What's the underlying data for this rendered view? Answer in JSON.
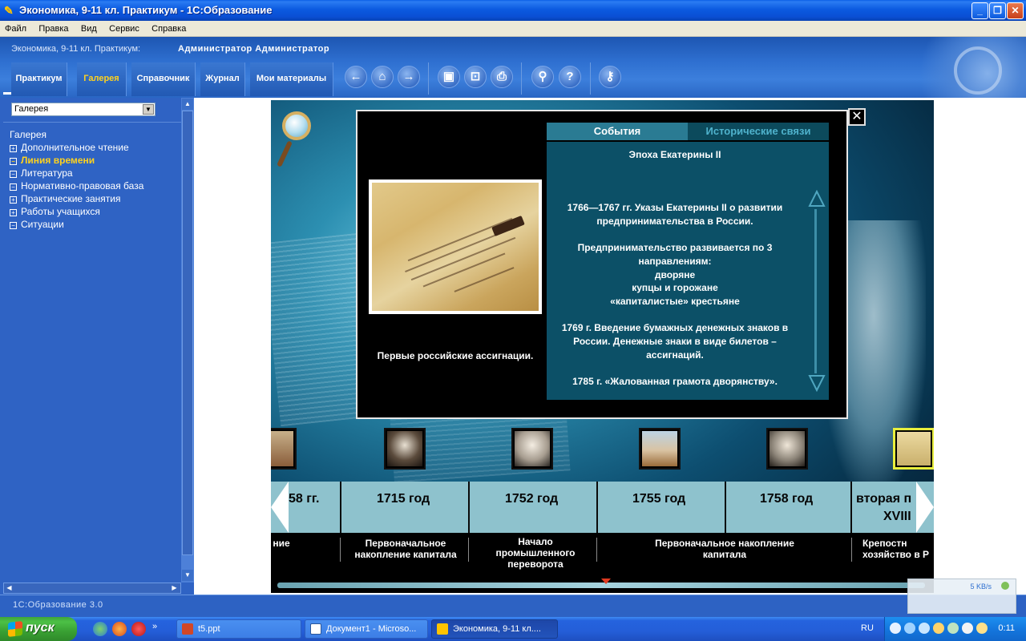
{
  "window": {
    "title": "Экономика, 9-11 кл. Практикум - 1С:Образование",
    "controls": [
      "minimize",
      "maximize",
      "close"
    ]
  },
  "menubar": [
    "Файл",
    "Правка",
    "Вид",
    "Сервис",
    "Справка"
  ],
  "app_header": {
    "course": "Экономика, 9-11 кл. Практикум:",
    "user": "Администратор Администратор",
    "nav_tabs": [
      {
        "label": "Практикум",
        "active": false
      },
      {
        "label": "Галерея",
        "active": true
      },
      {
        "label": "Справочник",
        "active": false
      },
      {
        "label": "Журнал",
        "active": false
      },
      {
        "label": "Мои материалы",
        "active": false
      }
    ],
    "toolbar_icons": [
      "arrow-left-icon",
      "home-icon",
      "arrow-right-icon",
      "fullscreen-icon",
      "presentation-icon",
      "print-icon",
      "search-icon",
      "help-icon",
      "key-icon"
    ]
  },
  "sidebar": {
    "select_value": "Галерея",
    "tree": [
      {
        "label": "Галерея",
        "box": ""
      },
      {
        "label": "Дополнительное чтение",
        "box": "+"
      },
      {
        "label": "Линия времени",
        "box": "−",
        "active": true
      },
      {
        "label": "Литература",
        "box": "−"
      },
      {
        "label": "Нормативно-правовая база",
        "box": "−"
      },
      {
        "label": "Практические занятия",
        "box": "+"
      },
      {
        "label": "Работы учащихся",
        "box": "+"
      },
      {
        "label": "Ситуации",
        "box": "−"
      }
    ]
  },
  "status": "1С:Образование 3.0",
  "modal": {
    "tabs": {
      "events": "События",
      "links": "Исторические связи"
    },
    "image_caption": "Первые российские ассигнации.",
    "header": "Эпоха Екатерины II",
    "events": [
      "1766—1767 гг. Указы Екатерины II о развитии предпринимательства в России.",
      "Предпринимательство развивается по  3 направлениям:",
      "дворяне",
      "купцы и горожане",
      "«капиталистые» крестьяне",
      "1769 г. Введение бумажных денежных знаков в России.  Денежные знаки в виде билетов – ассигнаций.",
      "1785 г. «Жалованная грамота дворянству»."
    ]
  },
  "timeline": {
    "years": [
      "58 гг.",
      "1715 год",
      "1752 год",
      "1755 год",
      "1758 год",
      "вторая п",
      "XVIII"
    ],
    "epochs": [
      "ние",
      "Первоначальное накопление капитала",
      "Начало промышленного переворота",
      "Первоначальное накопление капитала",
      "Крепостн хозяйство в Р"
    ]
  },
  "network": {
    "speed": "5 KB/s"
  },
  "taskbar": {
    "start": "пуск",
    "tasks": [
      {
        "label": "t5.ppt",
        "active": false
      },
      {
        "label": "Документ1 - Microso...",
        "active": false
      },
      {
        "label": "Экономика, 9-11 кл....",
        "active": true
      }
    ],
    "lang": "RU",
    "clock": "0:11"
  },
  "colors": {
    "accent_yellow": "#ffd21e",
    "sidebar_blue": "#2f63c4",
    "timeline_teal": "#8ec2cd",
    "xp_start_green": "#3fa43b"
  }
}
